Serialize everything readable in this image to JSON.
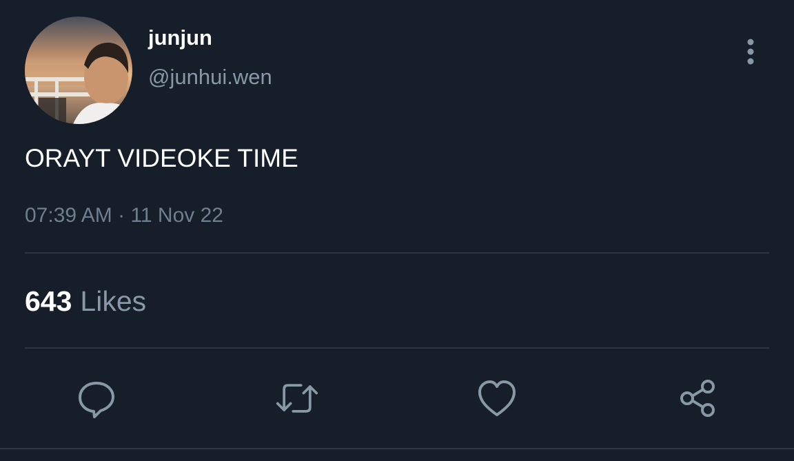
{
  "author": {
    "display_name": "junjun",
    "handle": "@junhui.wen",
    "avatar_icon": "profile-photo"
  },
  "tweet": {
    "text": "ORAYT VIDEOKE TIME",
    "time": "07:39 AM",
    "separator": "·",
    "date": "11 Nov 22"
  },
  "stats": {
    "likes_count": "643",
    "likes_label": "Likes"
  },
  "actions": {
    "reply_icon": "speech-bubble",
    "retweet_icon": "retweet-arrows",
    "like_icon": "heart",
    "share_icon": "share-nodes",
    "more_icon": "vertical-ellipsis"
  },
  "colors": {
    "background": "#161e2a",
    "primary_text": "#ffffff",
    "secondary_text": "#8899a6",
    "icon": "#8899a6",
    "divider": "#2b3744"
  }
}
